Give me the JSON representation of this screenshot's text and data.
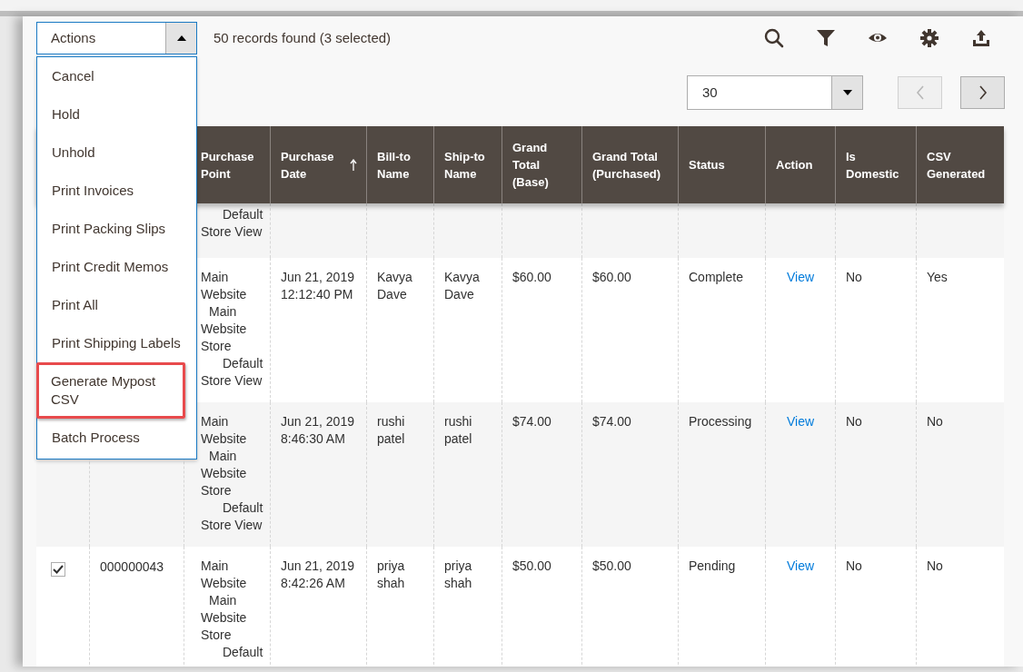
{
  "toolbar": {
    "actions_select": {
      "label": "Actions",
      "expanded": true
    },
    "records_text": "50 records found (3 selected)"
  },
  "actions_menu": [
    {
      "label": "Cancel",
      "highlighted": false
    },
    {
      "label": "Hold",
      "highlighted": false
    },
    {
      "label": "Unhold",
      "highlighted": false
    },
    {
      "label": "Print Invoices",
      "highlighted": false
    },
    {
      "label": "Print Packing Slips",
      "highlighted": false
    },
    {
      "label": "Print Credit Memos",
      "highlighted": false
    },
    {
      "label": "Print All",
      "highlighted": false
    },
    {
      "label": "Print Shipping Labels",
      "highlighted": false
    },
    {
      "label": "Generate Mypost CSV",
      "highlighted": true
    },
    {
      "label": "Batch Process",
      "highlighted": false
    }
  ],
  "pager": {
    "per_page": "30",
    "prev_disabled": true,
    "next_disabled": false
  },
  "table": {
    "columns": [
      {
        "label": "Purchase Point",
        "sorted": false
      },
      {
        "label": "Purchase Date",
        "sorted": true
      },
      {
        "label": "Bill-to Name",
        "sorted": false
      },
      {
        "label": "Ship-to Name",
        "sorted": false
      },
      {
        "label": "Grand Total (Base)",
        "sorted": false
      },
      {
        "label": "Grand Total (Purchased)",
        "sorted": false
      },
      {
        "label": "Status",
        "sorted": false
      },
      {
        "label": "Action",
        "sorted": false
      },
      {
        "label": "Is Domestic",
        "sorted": false
      },
      {
        "label": "CSV Generated",
        "sorted": false
      }
    ],
    "rows": [
      {
        "purchase_point": {
          "store_view": "Default Store View"
        }
      },
      {
        "purchase_point": {
          "website": "Main Website",
          "store": "Main Website Store",
          "store_view": "Default Store View"
        },
        "purchase_date": "Jun 21, 2019 12:12:40 PM",
        "bill_to": "Kavya Dave",
        "ship_to": "Kavya Dave",
        "grand_total_base": "$60.00",
        "grand_total_purchased": "$60.00",
        "status": "Complete",
        "action": "View",
        "is_domestic": "No",
        "csv_generated": "Yes"
      },
      {
        "purchase_point": {
          "website": "Main Website",
          "store": "Main Website Store",
          "store_view": "Default Store View"
        },
        "purchase_date": "Jun 21, 2019 8:46:30 AM",
        "bill_to": "rushi patel",
        "ship_to": "rushi patel",
        "grand_total_base": "$74.00",
        "grand_total_purchased": "$74.00",
        "status": "Processing",
        "action": "View",
        "is_domestic": "No",
        "csv_generated": "No"
      },
      {
        "checked": true,
        "id": "000000043",
        "purchase_point": {
          "website": "Main Website",
          "store": "Main Website Store",
          "store_view": "Default"
        },
        "purchase_date": "Jun 21, 2019 8:42:26 AM",
        "bill_to": "priya shah",
        "ship_to": "priya shah",
        "grand_total_base": "$50.00",
        "grand_total_purchased": "$50.00",
        "status": "Pending",
        "action": "View",
        "is_domestic": "No",
        "csv_generated": "No"
      }
    ]
  }
}
